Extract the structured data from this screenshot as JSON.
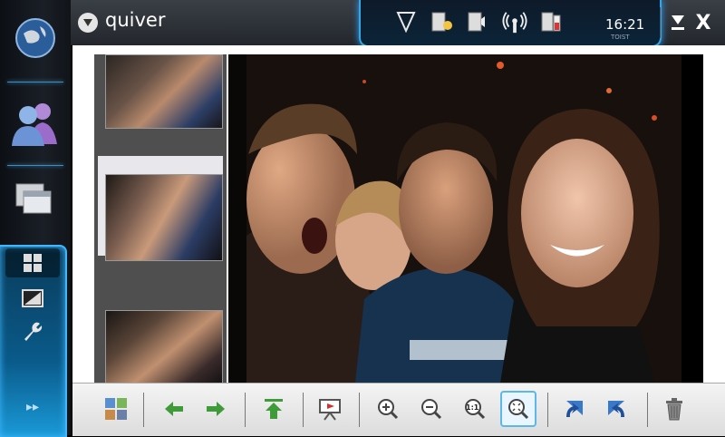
{
  "window": {
    "title": "quiver"
  },
  "status": {
    "clock": "16:21",
    "clock_sub": "TOIST"
  },
  "titlebar": {
    "minimize_label": "",
    "close_label": "X"
  },
  "navigator": {
    "items": [
      {
        "name": "web-browser-icon"
      },
      {
        "name": "contacts-icon"
      },
      {
        "name": "applications-icon"
      }
    ],
    "tool_items": [
      {
        "name": "thumbnails-icon",
        "selected": true
      },
      {
        "name": "fullscreen-icon",
        "selected": false
      },
      {
        "name": "settings-wrench-icon",
        "selected": false
      }
    ],
    "more_label": "▸▸"
  },
  "thumbnails": [
    {
      "name": "thumbnail-1",
      "selected": false
    },
    {
      "name": "thumbnail-2",
      "selected": true
    },
    {
      "name": "thumbnail-3",
      "selected": false
    }
  ],
  "toolbar": {
    "buttons": [
      {
        "name": "gallery-button"
      },
      {
        "name": "previous-button"
      },
      {
        "name": "next-button"
      },
      {
        "name": "upload-button"
      },
      {
        "name": "slideshow-button"
      },
      {
        "name": "zoom-in-button"
      },
      {
        "name": "zoom-out-button"
      },
      {
        "name": "zoom-1to1-button",
        "label": "1:1"
      },
      {
        "name": "zoom-fit-button",
        "active": true
      },
      {
        "name": "rotate-left-button"
      },
      {
        "name": "rotate-right-button"
      },
      {
        "name": "delete-button"
      }
    ]
  },
  "colors": {
    "accent": "#35a7e6",
    "titlebar": "#2b2f35",
    "toolbar": "#e6e6e6"
  }
}
